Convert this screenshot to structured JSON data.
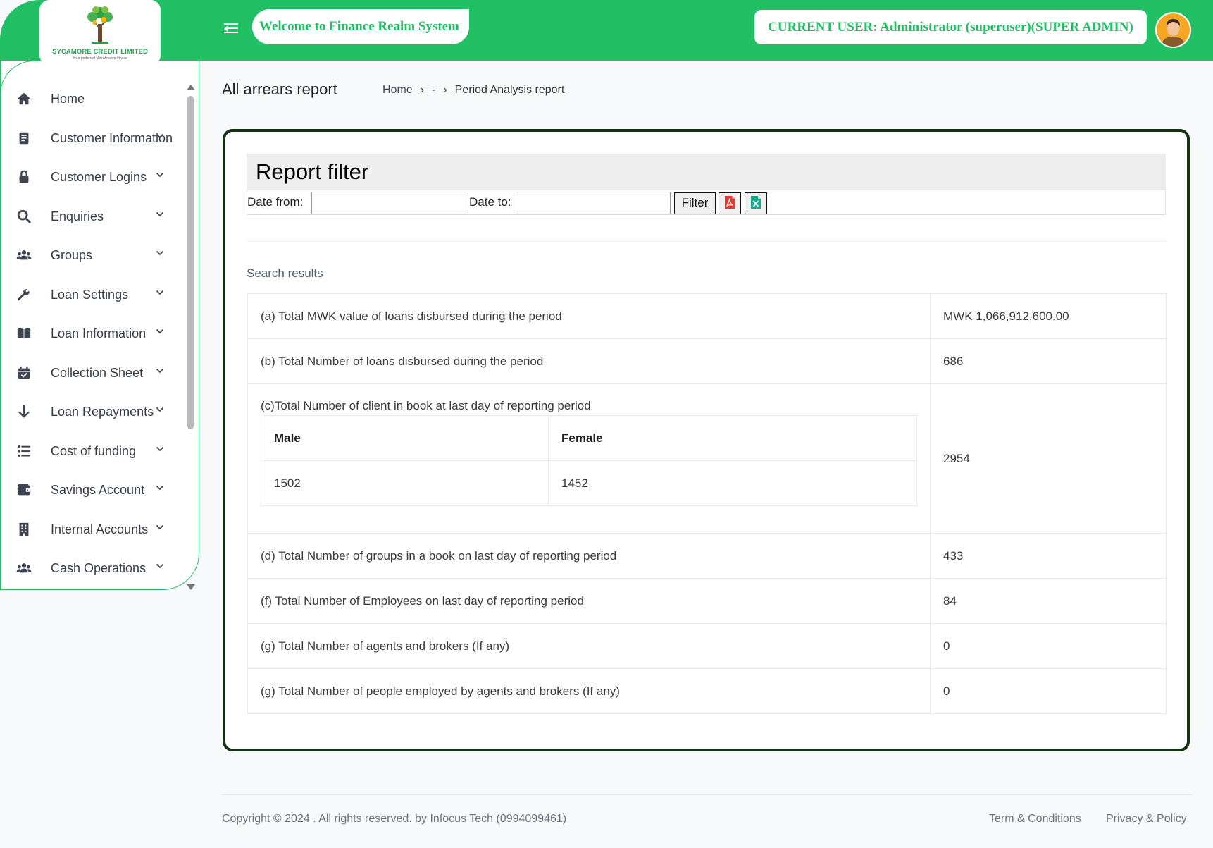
{
  "header": {
    "logo_name": "SYCAMORE CREDIT LIMITED",
    "logo_tagline": "Your preferred Microfinance House",
    "welcome": "Welcome to Finance Realm System",
    "current_user": "CURRENT USER: Administrator (superuser)(SUPER ADMIN)"
  },
  "sidebar": {
    "items": [
      {
        "label": "Home",
        "icon": "home-icon",
        "has_submenu": false
      },
      {
        "label": "Customer Information",
        "icon": "document-icon",
        "has_submenu": true
      },
      {
        "label": "Customer Logins",
        "icon": "lock-icon",
        "has_submenu": true
      },
      {
        "label": "Enquiries",
        "icon": "search-icon",
        "has_submenu": true
      },
      {
        "label": "Groups",
        "icon": "users-icon",
        "has_submenu": true
      },
      {
        "label": "Loan Settings",
        "icon": "wrench-icon",
        "has_submenu": true
      },
      {
        "label": "Loan Information",
        "icon": "book-icon",
        "has_submenu": true
      },
      {
        "label": "Collection Sheet",
        "icon": "calendar-check-icon",
        "has_submenu": true
      },
      {
        "label": "Loan Repayments",
        "icon": "arrow-down-icon",
        "has_submenu": true
      },
      {
        "label": "Cost of funding",
        "icon": "list-icon",
        "has_submenu": true
      },
      {
        "label": "Savings Account",
        "icon": "wallet-icon",
        "has_submenu": true
      },
      {
        "label": "Internal Accounts",
        "icon": "building-icon",
        "has_submenu": true
      },
      {
        "label": "Cash Operations",
        "icon": "users-icon",
        "has_submenu": true
      }
    ]
  },
  "page": {
    "title": "All arrears report",
    "breadcrumb": [
      "Home",
      "-",
      "Period Analysis report"
    ]
  },
  "filter": {
    "heading": "Report filter",
    "date_from_label": "Date from:",
    "date_from_value": "",
    "date_to_label": "Date to:",
    "date_to_value": "",
    "filter_button": "Filter",
    "pdf_icon": "pdf-export-icon",
    "excel_icon": "excel-export-icon"
  },
  "results": {
    "heading": "Search results",
    "rows": [
      {
        "label": "(a) Total MWK value of loans disbursed during the period",
        "value": "MWK 1,066,912,600.00"
      },
      {
        "label": "(b) Total Number of loans disbursed during the period",
        "value": "686"
      },
      {
        "label": "(c)Total Number of client in book at last day of reporting period",
        "value": "2954"
      },
      {
        "label": "(d) Total Number of groups in a book on last day of reporting period",
        "value": "433"
      },
      {
        "label": "(f) Total Number of Employees on last day of reporting period",
        "value": "84"
      },
      {
        "label": "(g) Total Number of agents and brokers (If any)",
        "value": "0"
      },
      {
        "label": "(g) Total Number of people employed by agents and brokers (If any)",
        "value": "0"
      }
    ],
    "gender": {
      "male_label": "Male",
      "female_label": "Female",
      "male_value": "1502",
      "female_value": "1452"
    }
  },
  "footer": {
    "copyright": "Copyright © 2024 . All rights reserved. by Infocus Tech (0994099461)",
    "terms": "Term & Conditions",
    "privacy": "Privacy & Policy"
  },
  "colors": {
    "brand_green": "#22c065",
    "card_border": "#133212",
    "pdf_red": "#e53935",
    "excel_teal": "#1aa88a"
  }
}
